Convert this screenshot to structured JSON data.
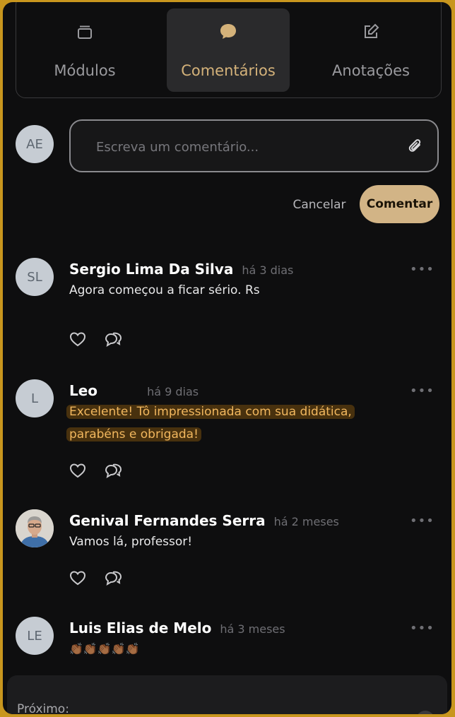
{
  "tabs": [
    {
      "label": "Módulos",
      "icon": "stack-icon",
      "active": false
    },
    {
      "label": "Comentários",
      "icon": "chat-bubble-icon",
      "active": true
    },
    {
      "label": "Anotações",
      "icon": "edit-note-icon",
      "active": false
    }
  ],
  "composer": {
    "avatar_initials": "AE",
    "placeholder": "Escreva um comentário...",
    "cancel_label": "Cancelar",
    "submit_label": "Comentar"
  },
  "comments": [
    {
      "initials": "SL",
      "name": "Sergio Lima Da Silva",
      "time": "há 3 dias",
      "text": "Agora começou a ficar sério. Rs"
    },
    {
      "initials": "L",
      "name": "Leo",
      "time": "há 9 dias",
      "text_line1": "Excelente! Tô impressionada com sua didática,",
      "text_line2": "parabéns e obrigada!"
    },
    {
      "initials": "",
      "name": "Genival Fernandes Serra",
      "time": "há 2 meses",
      "text": "Vamos lá, professor!"
    },
    {
      "initials": "LE",
      "name": "Luis Elias de Melo",
      "time": "há 3 meses",
      "text": "👏🏾👏🏾👏🏾👏🏾👏🏾"
    }
  ],
  "footer": {
    "next_label": "Próximo:"
  },
  "colors": {
    "accent": "#d2b486",
    "background": "#0e0e0f",
    "highlight_text": "#f1b75e",
    "border": "#c8961e"
  }
}
